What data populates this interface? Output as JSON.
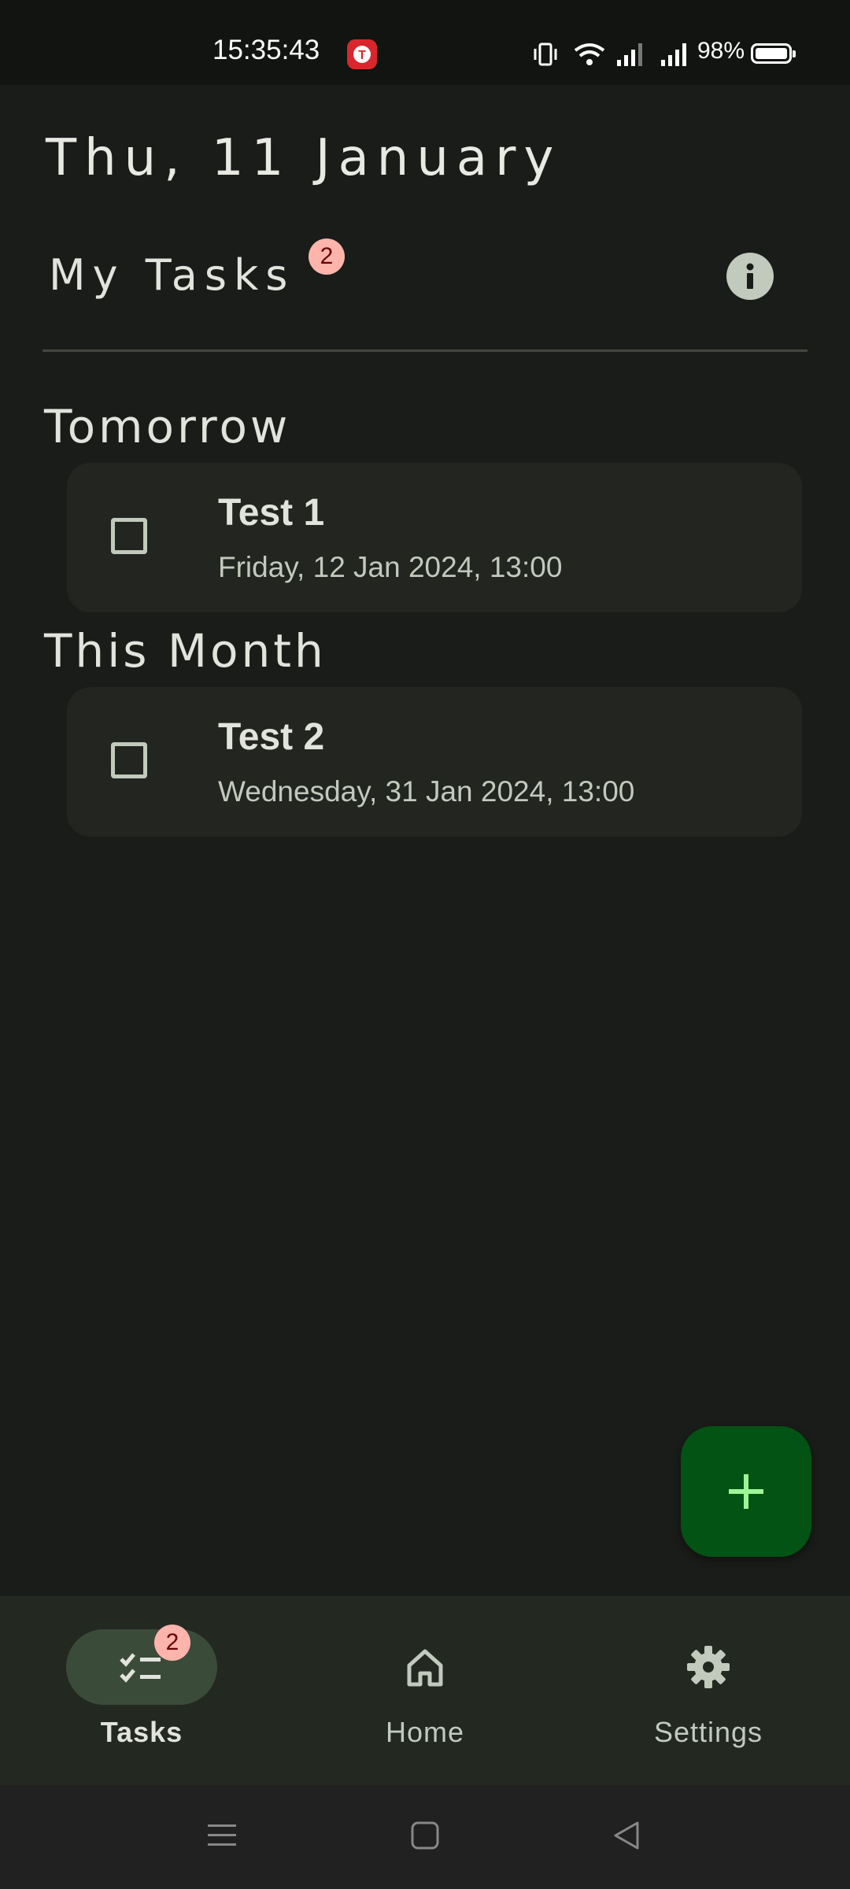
{
  "status_bar": {
    "time": "15:35:43",
    "battery": "98%",
    "icons": [
      "app-notification-icon",
      "vibrate-icon",
      "wifi-icon",
      "signal-icon",
      "signal-icon",
      "battery-icon"
    ]
  },
  "header": {
    "date": "Thu, 11 January",
    "title": "My Tasks",
    "badge_count": "2",
    "info_icon": "info-icon"
  },
  "sections": [
    {
      "title": "Tomorrow",
      "tasks": [
        {
          "title": "Test 1",
          "due": "Friday, 12 Jan 2024, 13:00",
          "done": false
        }
      ]
    },
    {
      "title": "This Month",
      "tasks": [
        {
          "title": "Test 2",
          "due": "Wednesday, 31 Jan 2024, 13:00",
          "done": false
        }
      ]
    }
  ],
  "fab": {
    "icon": "plus-icon"
  },
  "bottom_nav": {
    "items": [
      {
        "label": "Tasks",
        "icon": "task-list-icon",
        "badge": "2",
        "active": true
      },
      {
        "label": "Home",
        "icon": "home-icon",
        "active": false
      },
      {
        "label": "Settings",
        "icon": "gear-icon",
        "active": false
      }
    ]
  },
  "system_nav": {
    "icons": [
      "menu-icon",
      "home-square-icon",
      "back-icon"
    ]
  },
  "colors": {
    "background": "#1a1c19",
    "card": "#222520",
    "fab": "#025314",
    "fab_icon": "#9ef598",
    "badge": "#ffb4ab",
    "nav_pill": "#3b4b39"
  }
}
